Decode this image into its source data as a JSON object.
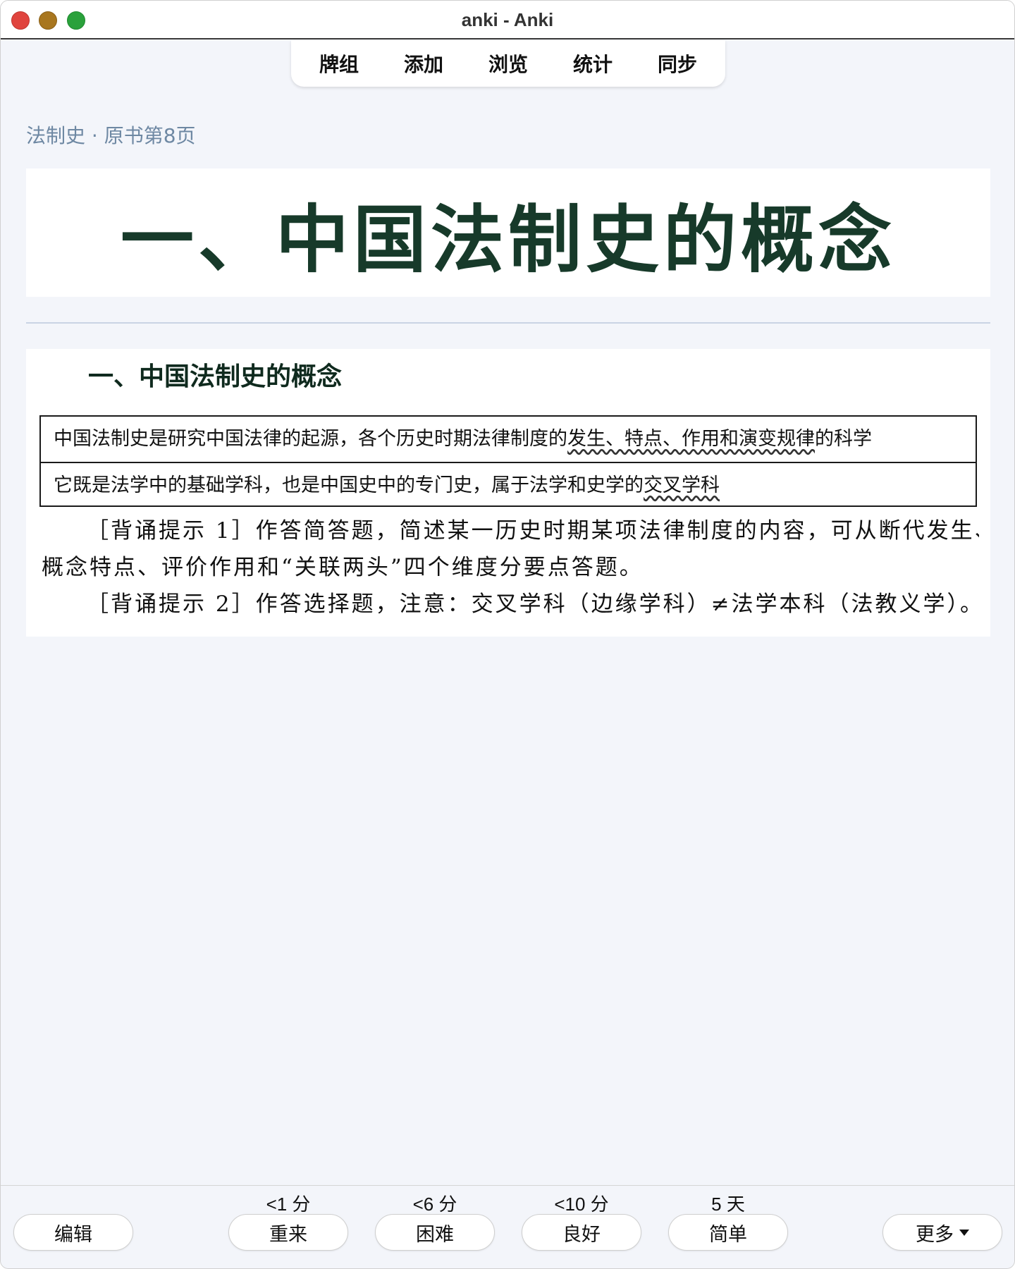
{
  "window": {
    "title": "anki - Anki"
  },
  "toolbar": {
    "items": [
      {
        "label": "牌组"
      },
      {
        "label": "添加"
      },
      {
        "label": "浏览"
      },
      {
        "label": "统计"
      },
      {
        "label": "同步"
      }
    ]
  },
  "card": {
    "breadcrumb": "法制史 · 原书第8页",
    "banner_title": "一、中国法制史的概念",
    "section_title": "一、中国法制史的概念",
    "table": {
      "row1": {
        "before": "中国法制史是研究中国法律的起源，各个历史时期法律制度的",
        "marked": "发生、特点、作用和演变规律",
        "after": "的科学"
      },
      "row2": {
        "before": "它既是法学中的基础学科，也是中国史中的专门史，属于法学和史学的",
        "marked": "交叉学科",
        "after": ""
      }
    },
    "tip1_line1": "［背诵提示 1］作答简答题，简述某一历史时期某项法律制度的内容，可从断代发生、",
    "tip1_line2": "概念特点、评价作用和“关联两头”四个维度分要点答题。",
    "tip2": "［背诵提示 2］作答选择题，注意：交叉学科（边缘学科）≠法学本科（法教义学）。"
  },
  "answer_bar": {
    "edit_label": "编辑",
    "more_label": "更多",
    "buttons": [
      {
        "label": "重来",
        "interval": "<1 分"
      },
      {
        "label": "困难",
        "interval": "<6 分"
      },
      {
        "label": "良好",
        "interval": "<10 分"
      },
      {
        "label": "简单",
        "interval": "5 天"
      }
    ]
  },
  "colors": {
    "background": "#f3f5fa",
    "breadcrumb": "#6e88a3",
    "banner_text": "#173a2a",
    "close": "#e0443e",
    "minimize": "#a8761f",
    "zoom": "#2aa13b"
  }
}
